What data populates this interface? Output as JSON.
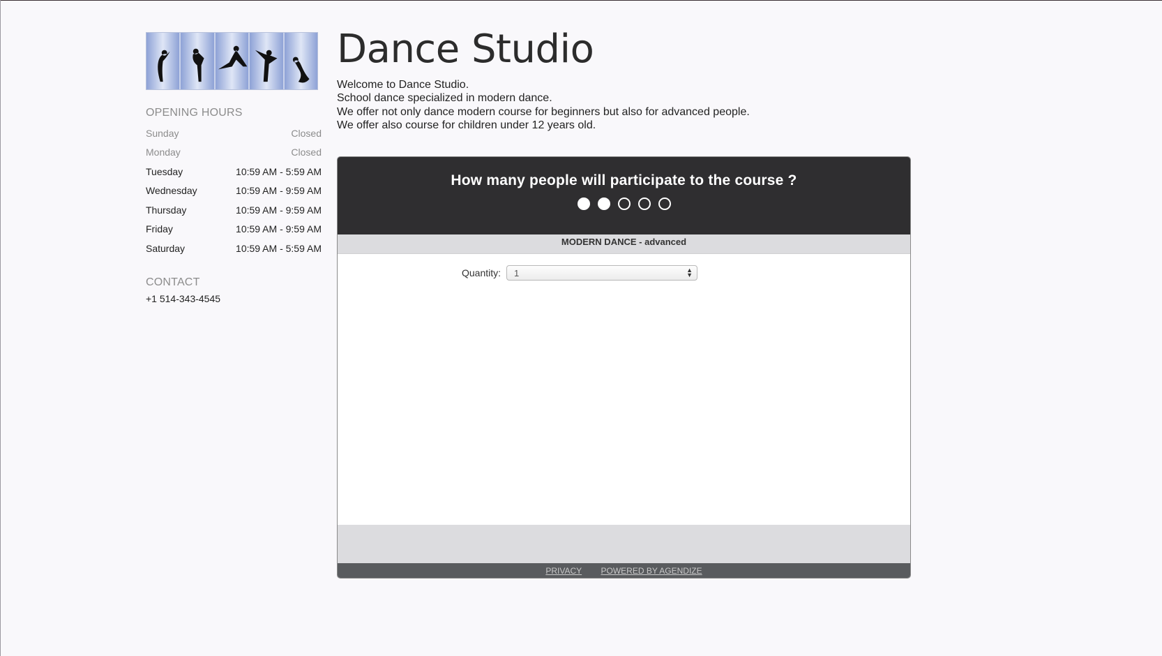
{
  "site": {
    "title": "Dance Studio",
    "intro": [
      "Welcome to Dance Studio.",
      "School dance specialized in modern dance.",
      "We offer not only dance modern course for beginners but also for advanced people.",
      "We offer also course for children under 12 years old."
    ]
  },
  "sidebar": {
    "hours_title": "OPENING HOURS",
    "hours": [
      {
        "day": "Sunday",
        "time": "Closed"
      },
      {
        "day": "Monday",
        "time": "Closed"
      },
      {
        "day": "Tuesday",
        "time": "10:59 AM - 5:59 AM"
      },
      {
        "day": "Wednesday",
        "time": "10:59 AM - 9:59 AM"
      },
      {
        "day": "Thursday",
        "time": "10:59 AM - 9:59 AM"
      },
      {
        "day": "Friday",
        "time": "10:59 AM - 9:59 AM"
      },
      {
        "day": "Saturday",
        "time": "10:59 AM - 5:59 AM"
      }
    ],
    "contact_title": "CONTACT",
    "phone": "+1 514-343-4545"
  },
  "widget": {
    "question": "How many people will participate to the course ?",
    "steps": {
      "total": 5,
      "completed": 2
    },
    "course_name": "MODERN DANCE - advanced",
    "quantity_label": "Quantity:",
    "quantity_value": "1",
    "footer_links": {
      "privacy": "PRIVACY",
      "powered": "POWERED BY AGENDIZE"
    }
  }
}
